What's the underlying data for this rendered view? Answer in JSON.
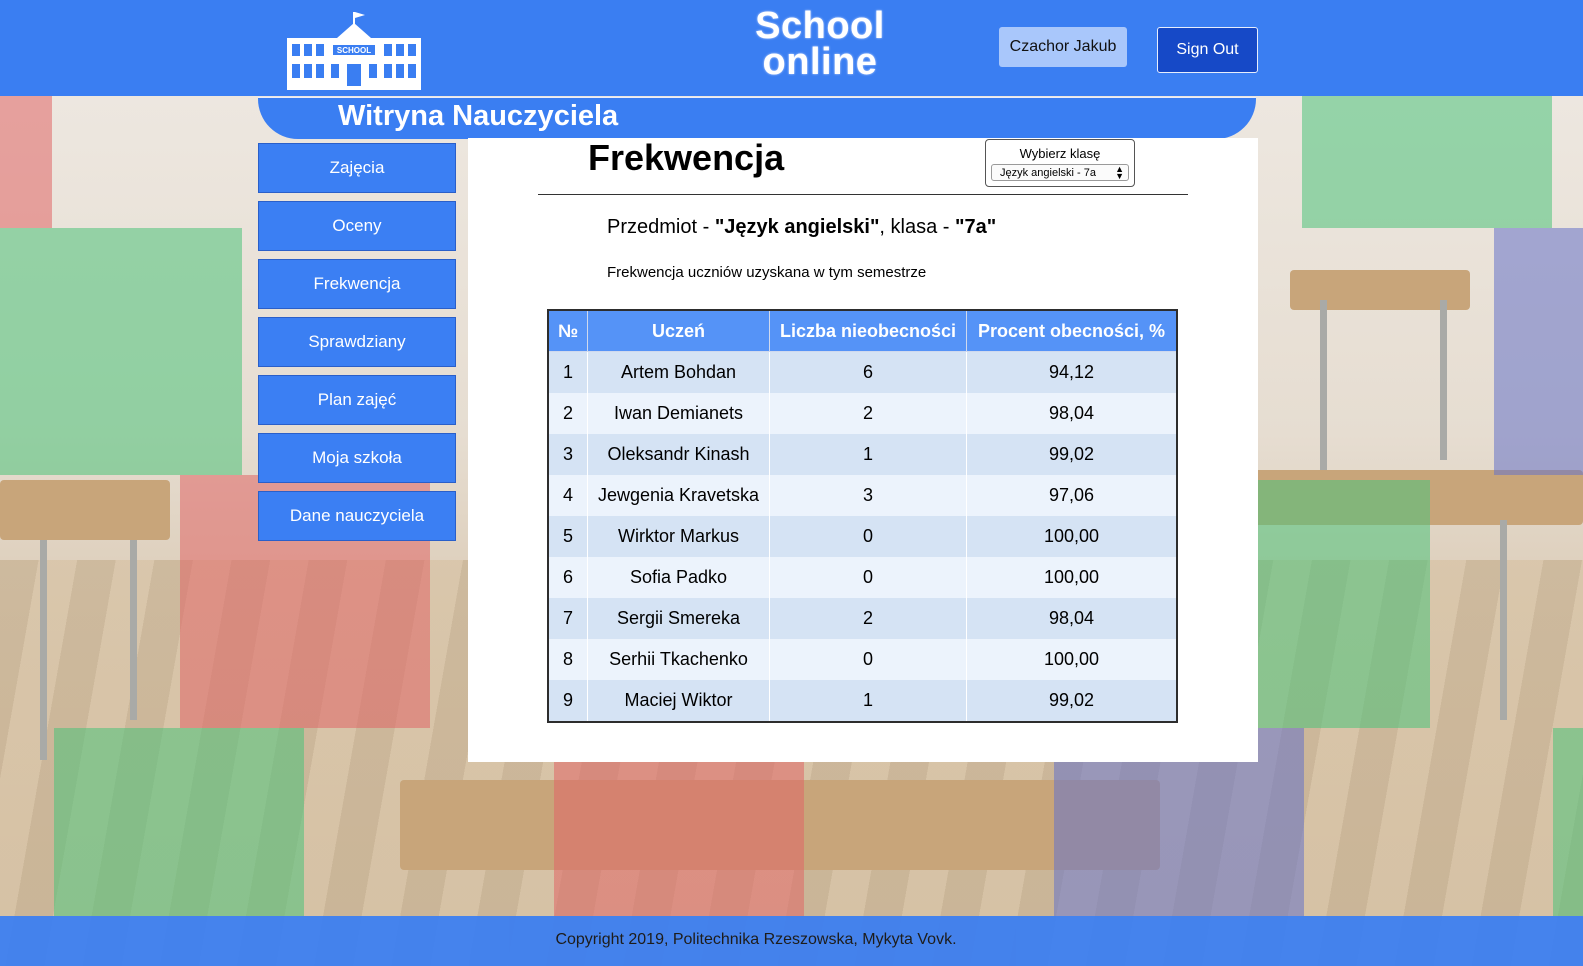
{
  "app": {
    "brand_line1": "School",
    "brand_line2": "online",
    "logo_text": "SCHOOL"
  },
  "header": {
    "user_name": "Czachor Jakub",
    "sign_out_label": "Sign Out",
    "portal_title": "Witryna Nauczyciela"
  },
  "sidebar": {
    "items": [
      {
        "label": "Zajęcia"
      },
      {
        "label": "Oceny"
      },
      {
        "label": "Frekwencja"
      },
      {
        "label": "Sprawdziany"
      },
      {
        "label": "Plan zajęć"
      },
      {
        "label": "Moja szkoła"
      },
      {
        "label": "Dane nauczyciela"
      }
    ]
  },
  "main": {
    "title": "Frekwencja",
    "class_picker": {
      "label": "Wybierz klasę",
      "selected": "Język angielski - 7a"
    },
    "subject_prefix": "Przedmiot - ",
    "subject_name": "\"Język angielski\"",
    "class_prefix": ", klasa - ",
    "class_name": "\"7a\"",
    "description": "Frekwencja uczniów uzyskana w tym semestrze",
    "table": {
      "headers": [
        "№",
        "Uczeń",
        "Liczba nieobecności",
        "Procent obecności, %"
      ],
      "rows": [
        [
          "1",
          "Artem Bohdan",
          "6",
          "94,12"
        ],
        [
          "2",
          "Iwan Demianets",
          "2",
          "98,04"
        ],
        [
          "3",
          "Oleksandr Kinash",
          "1",
          "99,02"
        ],
        [
          "4",
          "Jewgenia Kravetska",
          "3",
          "97,06"
        ],
        [
          "5",
          "Wirktor Markus",
          "0",
          "100,00"
        ],
        [
          "6",
          "Sofia Padko",
          "0",
          "100,00"
        ],
        [
          "7",
          "Sergii Smereka",
          "2",
          "98,04"
        ],
        [
          "8",
          "Serhii Tkachenko",
          "0",
          "100,00"
        ],
        [
          "9",
          "Maciej Wiktor",
          "1",
          "99,02"
        ]
      ]
    }
  },
  "footer": {
    "text": "Copyright 2019, Politechnika Rzeszowska, Mykyta Vovk."
  },
  "colors": {
    "primary": "#3a7ef2",
    "dark_button": "#1649c7",
    "header_cell": "#5593f7"
  }
}
